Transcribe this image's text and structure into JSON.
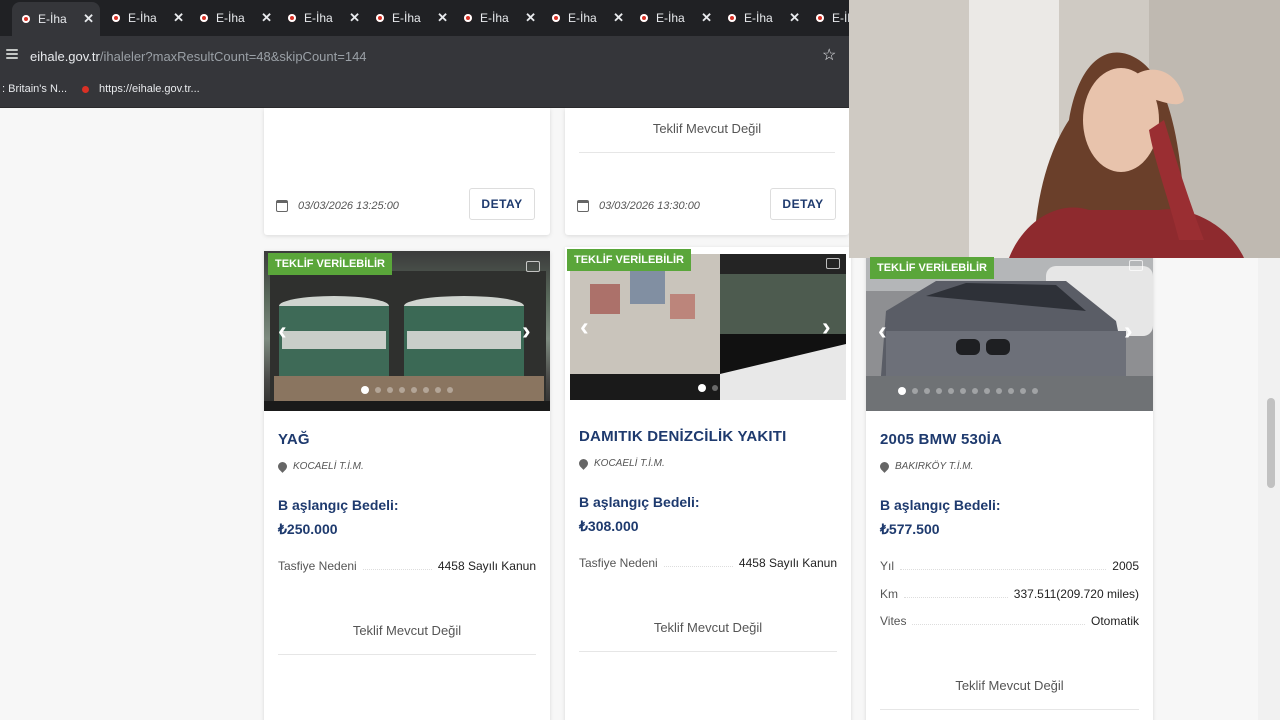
{
  "browser": {
    "tabs": [
      {
        "title": "E-İha"
      },
      {
        "title": "E-İha"
      },
      {
        "title": "E-İha"
      },
      {
        "title": "E-İha"
      },
      {
        "title": "E-İha"
      },
      {
        "title": "E-İha"
      },
      {
        "title": "E-İha"
      },
      {
        "title": "E-İha"
      },
      {
        "title": "E-İha"
      },
      {
        "title": "E-İh"
      }
    ],
    "address": {
      "domain": "eihale.gov.tr",
      "path": "/ihaleler?maxResultCount=48&skipCount=144"
    },
    "bookmarks": [
      {
        "label": ": Britain's N..."
      },
      {
        "label": "https://eihale.gov.tr..."
      }
    ]
  },
  "top_cards": [
    {
      "offer_status": "",
      "date": "03/03/2026 13:25:00",
      "detail_label": "DETAY"
    },
    {
      "offer_status": "Teklif Mevcut Değil",
      "date": "03/03/2026 13:30:00",
      "detail_label": "DETAY"
    }
  ],
  "listings": [
    {
      "badge": "TEKLİF VERİLEBİLİR",
      "title": "YAĞ",
      "location": "KOCAELİ T.İ.M.",
      "price_label": "B aşlangıç Bedeli:",
      "price": "₺250.000",
      "specs": [
        {
          "key": "Tasfiye Nedeni",
          "value": "4458 Sayılı Kanun"
        }
      ],
      "offer_status": "Teklif Mevcut Değil",
      "image_count": 8
    },
    {
      "badge": "TEKLİF VERİLEBİLİR",
      "title": "DAMITIK DENİZCİLİK YAKITI",
      "location": "KOCAELİ T.İ.M.",
      "price_label": "B aşlangıç Bedeli:",
      "price": "₺308.000",
      "specs": [
        {
          "key": "Tasfiye Nedeni",
          "value": "4458 Sayılı Kanun"
        }
      ],
      "offer_status": "Teklif Mevcut Değil",
      "image_count": 2
    },
    {
      "badge": "TEKLİF VERİLEBİLİR",
      "title": "2005 BMW 530İA",
      "location": "BAKIRKÖY T.İ.M.",
      "price_label": "B aşlangıç Bedeli:",
      "price": "₺577.500",
      "specs": [
        {
          "key": "Yıl",
          "value": "2005"
        },
        {
          "key": "Km",
          "value": "337.511(209.720 miles)"
        },
        {
          "key": "Vites",
          "value": "Otomatik"
        }
      ],
      "offer_status": "Teklif Mevcut Değil",
      "image_count": 12
    }
  ],
  "colors": {
    "accent": "#1e3a6e",
    "badge": "#5aa63a",
    "tab_favicon": "#d93025"
  }
}
